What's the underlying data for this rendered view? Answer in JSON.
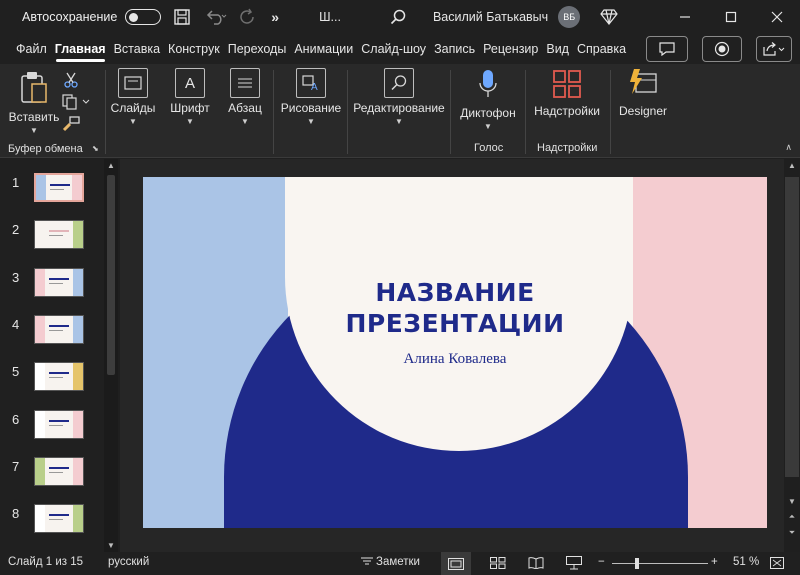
{
  "titlebar": {
    "autosave_label": "Автосохранение",
    "doc_title": "Ш...",
    "user_name": "Василий Батькавыч",
    "avatar_initials": "ВБ"
  },
  "tabs": [
    "Файл",
    "Главная",
    "Вставка",
    "Конструк",
    "Переходы",
    "Анимации",
    "Слайд-шоу",
    "Запись",
    "Рецензир",
    "Вид",
    "Справка"
  ],
  "ribbon": {
    "paste_label": "Вставить",
    "clipboard_group": "Буфер обмена",
    "slides_label": "Слайды",
    "font_label": "Шрифт",
    "paragraph_label": "Абзац",
    "drawing_label": "Рисование",
    "editing_label": "Редактирование",
    "dictate_label": "Диктофон",
    "voice_group": "Голос",
    "addins_label": "Надстройки",
    "addins_group": "Надстройки",
    "designer_label": "Designer"
  },
  "thumbnails": [
    "1",
    "2",
    "3",
    "4",
    "5",
    "6",
    "7",
    "8"
  ],
  "slide": {
    "title_line1": "НАЗВАНИЕ",
    "title_line2": "ПРЕЗЕНТАЦИИ",
    "author": "Алина Ковалева",
    "colors": {
      "left_band": "#aac4e6",
      "right_band": "#f4ccd0",
      "arch": "#1f2a8a",
      "circle": "#f9f5f1",
      "title": "#1f2a8a"
    }
  },
  "status": {
    "slide_counter": "Слайд 1 из 15",
    "language": "русский",
    "notes_label": "Заметки",
    "zoom": "51 %",
    "zoom_level": 0.51
  }
}
